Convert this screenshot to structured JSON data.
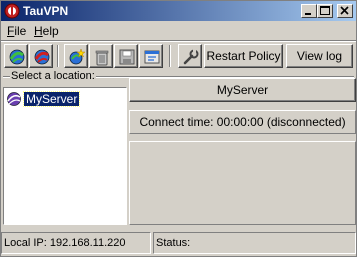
{
  "window": {
    "title": "TauVPN"
  },
  "menu": {
    "file": "File",
    "file_mnemonic": "F",
    "file_rest": "ile",
    "help": "Help",
    "help_mnemonic": "H",
    "help_rest": "elp"
  },
  "toolbar": {
    "icons": [
      "connect-icon",
      "disconnect-icon",
      "new-location-icon",
      "delete-icon",
      "save-icon",
      "properties-icon",
      "settings-icon"
    ],
    "restart_policy": "Restart Policy",
    "view_log": "View log"
  },
  "locations": {
    "label": "Select a location:",
    "items": [
      {
        "name": "MyServer",
        "selected": true
      }
    ]
  },
  "panel": {
    "server_name": "MyServer",
    "connect_time": "Connect time: 00:00:00 (disconnected)"
  },
  "status": {
    "local_ip": "Local IP: 192.168.11.220",
    "status": "Status:"
  },
  "colors": {
    "titlebar_start": "#0a246a",
    "titlebar_end": "#a6caf0",
    "selection": "#0a246a",
    "face": "#d4d0c8"
  }
}
